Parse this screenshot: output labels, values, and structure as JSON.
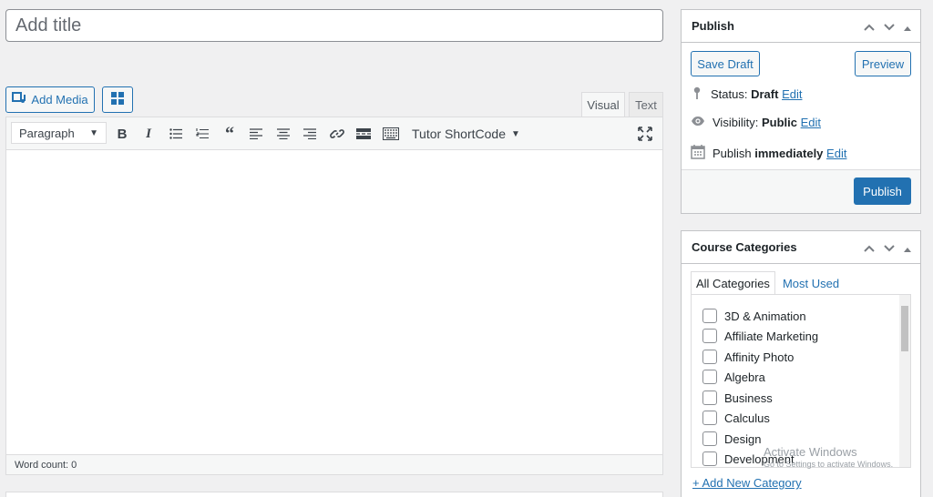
{
  "editor": {
    "title_placeholder": "Add title",
    "add_media_label": "Add Media",
    "tabs": {
      "visual": "Visual",
      "text": "Text"
    },
    "format_select": "Paragraph",
    "tutor_shortcode": "Tutor ShortCode",
    "word_count": "Word count: 0"
  },
  "publish_panel": {
    "title": "Publish",
    "save_draft": "Save Draft",
    "preview": "Preview",
    "status_label": "Status:",
    "status_value": "Draft",
    "visibility_label": "Visibility:",
    "visibility_value": "Public",
    "publish_label": "Publish",
    "publish_value": "immediately",
    "edit_link": "Edit",
    "publish_button": "Publish"
  },
  "categories_panel": {
    "title": "Course Categories",
    "tab_all": "All Categories",
    "tab_most_used": "Most Used",
    "items": [
      "3D & Animation",
      "Affiliate Marketing",
      "Affinity Photo",
      "Algebra",
      "Business",
      "Calculus",
      "Design",
      "Development"
    ],
    "add_new": "+ Add New Category"
  },
  "watermark": {
    "line1": "Activate Windows",
    "line2": "Go to Settings to activate Windows."
  }
}
